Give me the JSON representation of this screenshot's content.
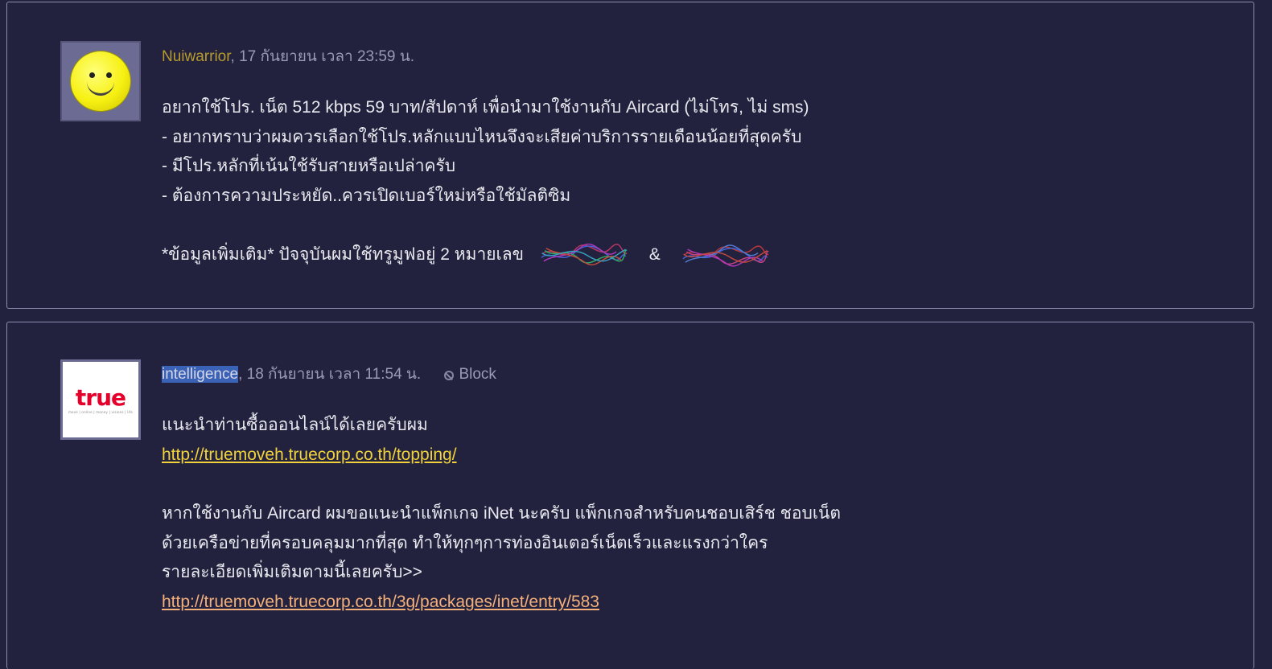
{
  "posts": [
    {
      "username": "Nuiwarrior",
      "meta_suffix": ", 17 กันยายน เวลา 23:59 น.",
      "avatar": "smiley-face-icon",
      "lines": [
        "อยากใช้โปร. เน็ต 512 kbps  59 บาท/สัปดาห์ เพื่อนำมาใช้งานกับ Aircard  (ไม่โทร, ไม่ sms)",
        "- อยากทราบว่าผมควรเลือกใช้โปร.หลักแบบไหนจึงจะเสียค่าบริการรายเดือนน้อยที่สุดครับ",
        "- มีโปร.หลักที่เน้นใช้รับสายหรือเปล่าครับ",
        "- ต้องการความประหยัด..ควรเปิดเบอร์ใหม่หรือใช้มัลติซิม"
      ],
      "extra_prefix": "*ข้อมูลเพิ่มเติม* ปัจจุบันผมใช้ทรูมูฟอยู่ 2 หมายเลข",
      "extra_sep": "&"
    },
    {
      "username": "intelligence",
      "meta_suffix": ", 18 กันยายน เวลา 11:54 น.",
      "block_label": "Block",
      "avatar_logo_text": "true",
      "avatar_logo_tagline": "move | online | money | visions | life",
      "line1": "แนะนำท่านซื้อออนไลน์ได้เลยครับผม",
      "link1": "http://truemoveh.truecorp.co.th/topping/",
      "para": [
        "หากใช้งานกับ Aircard ผมขอแนะนำแพ็กเกจ iNet นะครับ แพ็กเกจสำหรับคนชอบเสิร์ช ชอบเน็ต",
        "ด้วยเครือข่ายที่ครอบคลุมมากที่สุด ทำให้ทุกๆการท่องอินเตอร์เน็ตเร็วและแรงกว่าใคร",
        "รายละเอียดเพิ่มเติมตามนี้เลยครับ>>"
      ],
      "link2": "http://truemoveh.truecorp.co.th/3g/packages/inet/entry/583"
    }
  ],
  "colors": {
    "background": "#22223f",
    "username": "#b79a2c",
    "link_yellow": "#f2d23b",
    "link_orange": "#f4b07a",
    "selection": "#3a63b8"
  }
}
